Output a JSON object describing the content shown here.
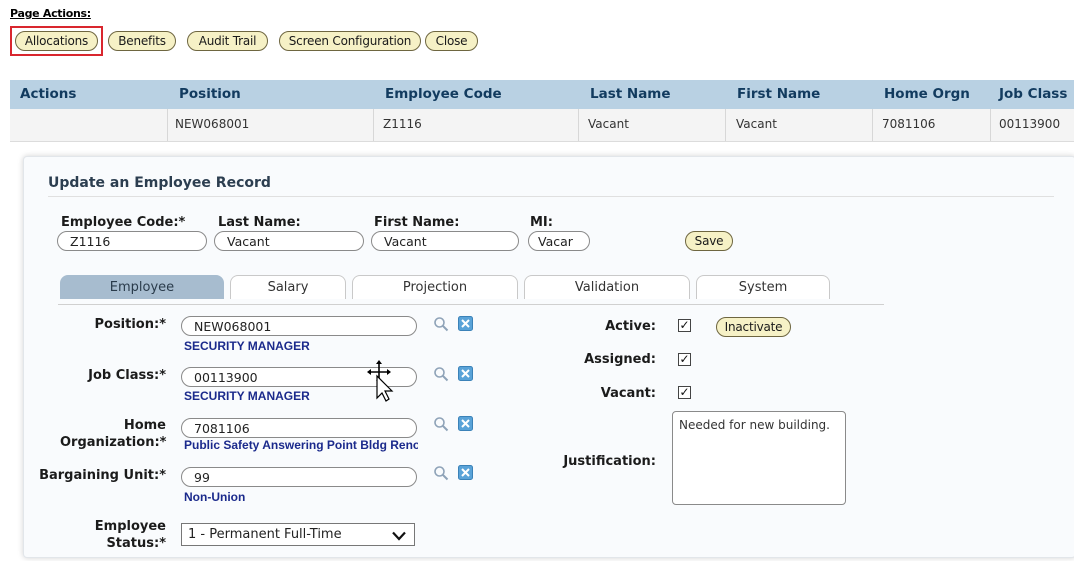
{
  "page_actions": {
    "label": "Page Actions:",
    "buttons": [
      "Allocations",
      "Benefits",
      "Audit Trail",
      "Screen Configuration",
      "Close"
    ]
  },
  "grid": {
    "headers": [
      "Actions",
      "Position",
      "Employee Code",
      "Last Name",
      "First Name",
      "Home Orgn",
      "Job Class"
    ],
    "row": [
      "",
      "NEW068001",
      "Z1116",
      "Vacant",
      "Vacant",
      "7081106",
      "00113900"
    ]
  },
  "form": {
    "title": "Update an Employee Record",
    "employee_code_label": "Employee Code:*",
    "employee_code_value": "Z1116",
    "last_name_label": "Last Name:",
    "last_name_value": "Vacant",
    "first_name_label": "First Name:",
    "first_name_value": "Vacant",
    "mi_label": "MI:",
    "mi_value": "Vacar",
    "save_label": "Save"
  },
  "tabs": [
    "Employee",
    "Salary",
    "Projection",
    "Validation",
    "System"
  ],
  "fields": {
    "position_label": "Position:*",
    "position_value": "NEW068001",
    "position_desc": "SECURITY MANAGER",
    "job_class_label": "Job Class:*",
    "job_class_value": "00113900",
    "job_class_desc": "SECURITY MANAGER",
    "home_label_1": "Home",
    "home_label_2": "Organization:*",
    "home_value": "7081106",
    "home_desc": "Public Safety Answering Point Bldg Renov",
    "bargaining_label": "Bargaining Unit:*",
    "bargaining_value": "99",
    "bargaining_desc": "Non-Union",
    "status_label_1": "Employee",
    "status_label_2": "Status:*",
    "status_value": "1 - Permanent Full-Time"
  },
  "flags": {
    "active_label": "Active:",
    "active_checked": true,
    "inactivate_label": "Inactivate",
    "assigned_label": "Assigned:",
    "assigned_checked": true,
    "vacant_label": "Vacant:",
    "vacant_checked": true,
    "justification_label": "Justification:",
    "justification_value": "Needed for new building."
  },
  "icons": {
    "lookup": "magnifier-icon",
    "clear": "clear-x-icon",
    "check": "✓"
  },
  "colors": {
    "header_bg": "#b9d1e3",
    "pill_bg": "#f6f1c6",
    "highlight": "#d9262e",
    "active_tab": "#a7bccf",
    "desc_text": "#1b2a8c"
  }
}
